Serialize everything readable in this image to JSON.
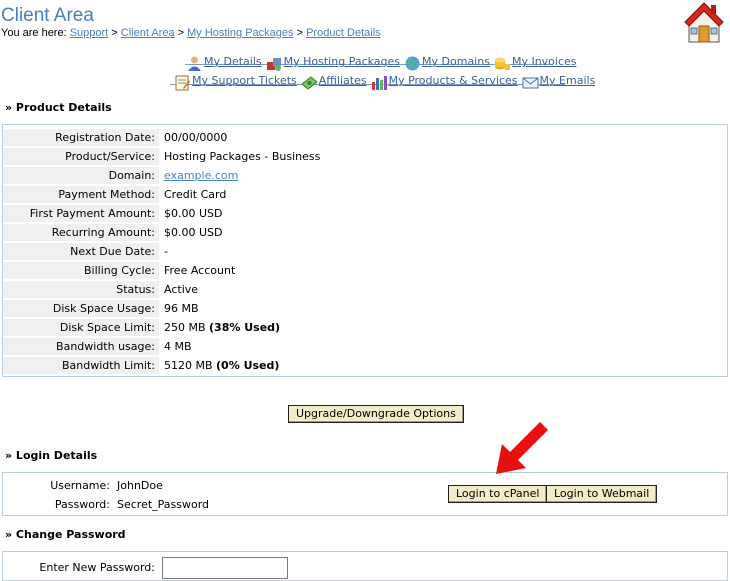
{
  "header": {
    "title": "Client Area",
    "breadcrumb_prefix": "You are here: ",
    "breadcrumb": [
      "Support",
      "Client Area",
      "My Hosting Packages",
      "Product Details"
    ],
    "breadcrumb_sep": " > "
  },
  "nav": {
    "row1": [
      "My Details",
      "My Hosting Packages",
      "My Domains",
      "My Invoices"
    ],
    "row2": [
      "My Support Tickets",
      "Affiliates",
      "My Products & Services",
      "My Emails"
    ]
  },
  "product": {
    "heading": "» Product Details",
    "rows": [
      {
        "label": "Registration Date:",
        "value": "00/00/0000"
      },
      {
        "label": "Product/Service:",
        "value": "Hosting Packages - Business"
      },
      {
        "label": "Domain:",
        "value": "example.com"
      },
      {
        "label": "Payment Method:",
        "value": "Credit Card"
      },
      {
        "label": "First Payment Amount:",
        "value": "$0.00 USD"
      },
      {
        "label": "Recurring Amount:",
        "value": "$0.00 USD"
      },
      {
        "label": "Next Due Date:",
        "value": "-"
      },
      {
        "label": "Billing Cycle:",
        "value": "Free Account"
      },
      {
        "label": "Status:",
        "value": "Active"
      },
      {
        "label": "Disk Space Usage:",
        "value": "96 MB"
      },
      {
        "label": "Disk Space Limit:",
        "value": "250 MB",
        "extra": "(38% Used)"
      },
      {
        "label": "Bandwidth usage:",
        "value": "4 MB"
      },
      {
        "label": "Bandwidth Limit:",
        "value": "5120 MB",
        "extra": "(0% Used)"
      }
    ],
    "upgrade_button": "Upgrade/Downgrade Options"
  },
  "login": {
    "heading": "» Login Details",
    "username_label": "Username:",
    "username": "JohnDoe",
    "password_label": "Password:",
    "password": "Secret_Password",
    "cpanel_button": "Login to cPanel",
    "webmail_button": "Login to Webmail"
  },
  "change_password": {
    "heading": "» Change Password",
    "new_label": "Enter New Password:"
  },
  "colors": {
    "accent": "#4a7ec0",
    "button_bg": "#f3ecc9",
    "arrow": "#e8100c"
  }
}
